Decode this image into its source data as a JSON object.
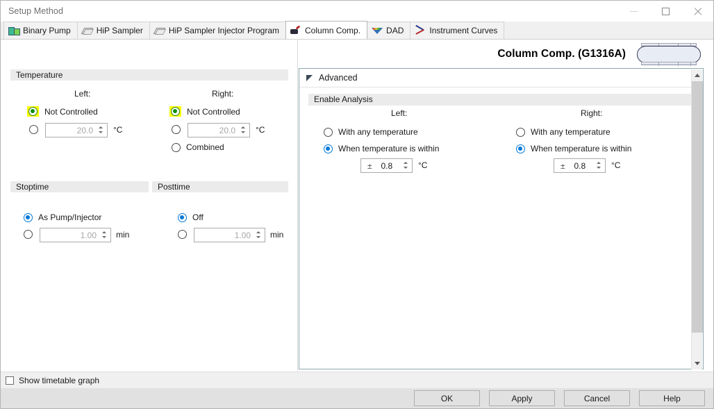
{
  "window": {
    "title": "Setup Method",
    "minimize_label": "Minimize",
    "maximize_label": "Maximize",
    "close_label": "Close"
  },
  "tabs": [
    {
      "label": "Binary Pump",
      "icon": "binary-pump-icon",
      "active": false
    },
    {
      "label": "HiP Sampler",
      "icon": "hip-sampler-icon",
      "active": false
    },
    {
      "label": "HiP Sampler Injector Program",
      "icon": "hip-sampler-injector-icon",
      "active": false
    },
    {
      "label": "Column Comp.",
      "icon": "column-comp-icon",
      "active": true
    },
    {
      "label": "DAD",
      "icon": "dad-icon",
      "active": false
    },
    {
      "label": "Instrument Curves",
      "icon": "instrument-curves-icon",
      "active": false
    }
  ],
  "device": {
    "title": "Column Comp. (G1316A)",
    "image_name": "column-compartment-graphic"
  },
  "temperature": {
    "group_label": "Temperature",
    "left_label": "Left:",
    "right_label": "Right:",
    "left": {
      "not_controlled_label": "Not Controlled",
      "not_controlled_selected": true,
      "highlighted": true,
      "setpoint_value": "20.0",
      "setpoint_unit": "°C",
      "setpoint_selected": false
    },
    "right": {
      "not_controlled_label": "Not Controlled",
      "not_controlled_selected": true,
      "highlighted": true,
      "setpoint_value": "20.0",
      "setpoint_unit": "°C",
      "setpoint_selected": false,
      "combined_label": "Combined",
      "combined_selected": false
    }
  },
  "stoptime": {
    "group_label": "Stoptime",
    "as_pump_label": "As Pump/Injector",
    "as_pump_selected": true,
    "value": "1.00",
    "unit": "min",
    "value_selected": false
  },
  "posttime": {
    "group_label": "Posttime",
    "off_label": "Off",
    "off_selected": true,
    "value": "1.00",
    "unit": "min",
    "value_selected": false
  },
  "advanced": {
    "header_label": "Advanced",
    "expanded": true,
    "enable_analysis_label": "Enable Analysis",
    "left_label": "Left:",
    "right_label": "Right:",
    "left": {
      "any_temp_label": "With any temperature",
      "any_temp_selected": false,
      "within_label": "When temperature is within",
      "within_selected": true,
      "tolerance_prefix": "±",
      "tolerance_value": "0.8",
      "tolerance_unit": "°C"
    },
    "right": {
      "any_temp_label": "With any temperature",
      "any_temp_selected": false,
      "within_label": "When temperature is within",
      "within_selected": true,
      "tolerance_prefix": "±",
      "tolerance_value": "0.8",
      "tolerance_unit": "°C"
    }
  },
  "footer": {
    "show_timetable_label": "Show timetable graph",
    "show_timetable_checked": false,
    "buttons": [
      {
        "label": "OK"
      },
      {
        "label": "Apply"
      },
      {
        "label": "Cancel"
      },
      {
        "label": "Help"
      }
    ]
  },
  "colors": {
    "highlight": "#ffff00",
    "radio_green": "#119011",
    "radio_blue": "#0078d7",
    "panel_border": "#8fa8ad",
    "group_header_bg": "#ebebeb"
  }
}
